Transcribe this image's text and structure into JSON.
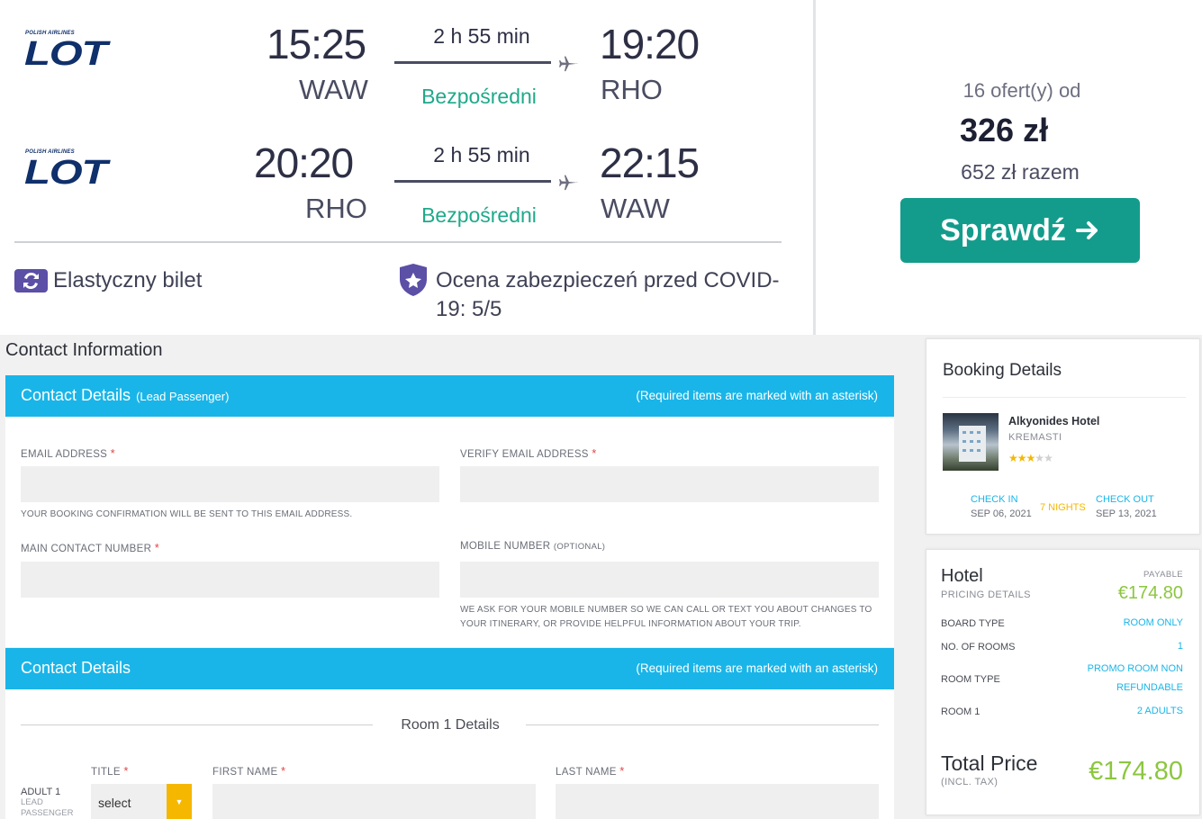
{
  "flight": {
    "legs": [
      {
        "airline_small": "POLISH AIRLINES",
        "airline_logo": "LOT",
        "dep_time": "15:25",
        "dep_code": "WAW",
        "duration": "2 h 55 min",
        "stops": "Bezpośredni",
        "arr_time": "19:20",
        "arr_code": "RHO"
      },
      {
        "airline_small": "POLISH AIRLINES",
        "airline_logo": "LOT",
        "dep_time": "20:20",
        "dep_code": "RHO",
        "duration": "2 h 55 min",
        "stops": "Bezpośredni",
        "arr_time": "22:15",
        "arr_code": "WAW"
      }
    ],
    "feature_flexible": "Elastyczny bilet",
    "feature_covid_1": "Ocena zabezpieczeń przed COVID-",
    "feature_covid_2": "19: 5/5",
    "offers": "16 ofert(y) od",
    "price": "326 zł",
    "total": "652 zł razem",
    "check_label": "Sprawdź",
    "colors": {
      "accent": "#139c8c",
      "direct": "#1fa98a",
      "logo": "#10306b",
      "badge": "#5b4fa6"
    }
  },
  "contact": {
    "section_title": "Contact Information",
    "bar1_title": "Contact Details",
    "bar1_sub": "(Lead Passenger)",
    "required_note": "(Required items are marked with an asterisk)",
    "email_label": "EMAIL ADDRESS",
    "verify_email_label": "VERIFY EMAIL ADDRESS",
    "email_hint": "YOUR BOOKING CONFIRMATION WILL BE SENT TO THIS EMAIL ADDRESS.",
    "main_contact_label": "MAIN CONTACT NUMBER",
    "mobile_label": "MOBILE NUMBER",
    "optional": "(OPTIONAL)",
    "mobile_hint_1": "WE ASK FOR YOUR MOBILE NUMBER SO WE CAN CALL OR TEXT YOU ABOUT CHANGES TO",
    "mobile_hint_2": "YOUR ITINERARY, OR PROVIDE HELPFUL INFORMATION ABOUT YOUR TRIP.",
    "asterisk": "*",
    "bar2_title": "Contact Details",
    "room_title": "Room 1 Details",
    "title_label": "TITLE",
    "first_name_label": "FIRST NAME",
    "last_name_label": "LAST NAME",
    "adult_label": "ADULT 1",
    "adult_sub_1": "LEAD",
    "adult_sub_2": "PASSENGER",
    "title_select": "select",
    "colors": {
      "bar": "#1ab5e8",
      "required": "#e24545",
      "caret": "#f5b700"
    }
  },
  "booking": {
    "title": "Booking Details",
    "hotel_name": "Alkyonides Hotel",
    "hotel_city": "KREMASTI",
    "stars_filled": 3,
    "stars_total": 5,
    "check_in_label": "CHECK IN",
    "check_in_date": "SEP 06, 2021",
    "nights": "7 NIGHTS",
    "check_out_label": "CHECK OUT",
    "check_out_date": "SEP 13, 2021"
  },
  "pricing": {
    "title": "Hotel",
    "subtitle": "PRICING DETAILS",
    "payable_label": "PAYABLE",
    "payable_amount": "€174.80",
    "rows": [
      {
        "label": "BOARD TYPE",
        "value": "ROOM ONLY"
      },
      {
        "label": "NO. OF ROOMS",
        "value": "1"
      },
      {
        "label": "ROOM TYPE",
        "value_1": "PROMO ROOM NON",
        "value_2": "REFUNDABLE"
      },
      {
        "label": "ROOM 1",
        "value": "2 ADULTS"
      }
    ],
    "total_label": "Total Price",
    "total_sub": "(INCL. TAX)",
    "total_amount": "€174.80",
    "colors": {
      "amount": "#8cc63f",
      "link": "#1ab5e8"
    }
  }
}
